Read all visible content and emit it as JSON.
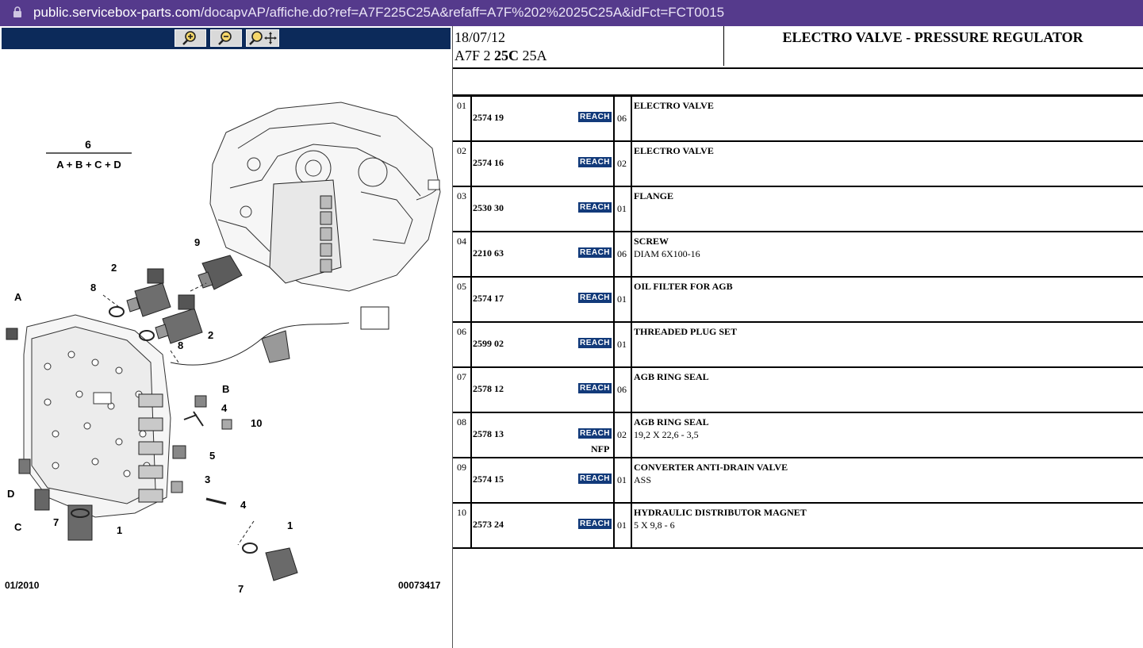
{
  "browser": {
    "url_host": "public.servicebox-parts.com",
    "url_path": "/docapvAP/affiche.do?ref=A7F225C25A&refaff=A7F%202%2025C25A&idFct=FCT0015"
  },
  "toolbar": {
    "zoom_in_icon": "zoom-in-icon",
    "zoom_out_icon": "zoom-out-icon",
    "zoom_pan_icon": "zoom-pan-icon"
  },
  "diagram": {
    "formula_top": "6",
    "formula_bottom": "A + B + C + D",
    "callouts": [
      "A",
      "B",
      "C",
      "D",
      "1",
      "2",
      "3",
      "4",
      "5",
      "7",
      "8",
      "9",
      "10"
    ],
    "date": "01/2010",
    "number": "00073417"
  },
  "header": {
    "date": "18/07/12",
    "code_prefix": "A7F 2 ",
    "code_bold": "25C",
    "code_suffix": " 25A",
    "title": "ELECTRO VALVE - PRESSURE REGULATOR"
  },
  "colors": {
    "address_bar": "#553a8c",
    "toolbar": "#0c2a5a",
    "reach_badge": "#123a7a"
  },
  "parts": [
    {
      "num": "01",
      "ref": "2574 19",
      "badge": "REACH",
      "qty": "06",
      "name": "ELECTRO VALVE",
      "detail": "",
      "note": ""
    },
    {
      "num": "02",
      "ref": "2574 16",
      "badge": "REACH",
      "qty": "02",
      "name": "ELECTRO VALVE",
      "detail": "",
      "note": ""
    },
    {
      "num": "03",
      "ref": "2530 30",
      "badge": "REACH",
      "qty": "01",
      "name": "FLANGE",
      "detail": "",
      "note": ""
    },
    {
      "num": "04",
      "ref": "2210 63",
      "badge": "REACH",
      "qty": "06",
      "name": "SCREW",
      "detail": "DIAM 6X100-16",
      "note": ""
    },
    {
      "num": "05",
      "ref": "2574 17",
      "badge": "REACH",
      "qty": "01",
      "name": "OIL FILTER FOR AGB",
      "detail": "",
      "note": ""
    },
    {
      "num": "06",
      "ref": "2599 02",
      "badge": "REACH",
      "qty": "01",
      "name": "THREADED PLUG SET",
      "detail": "",
      "note": ""
    },
    {
      "num": "07",
      "ref": "2578 12",
      "badge": "REACH",
      "qty": "06",
      "name": "AGB RING SEAL",
      "detail": "",
      "note": ""
    },
    {
      "num": "08",
      "ref": "2578 13",
      "badge": "REACH",
      "qty": "02",
      "name": "AGB RING SEAL",
      "detail": "19,2 X 22,6 - 3,5",
      "note": "NFP"
    },
    {
      "num": "09",
      "ref": "2574 15",
      "badge": "REACH",
      "qty": "01",
      "name": "CONVERTER ANTI-DRAIN VALVE",
      "detail": "ASS",
      "note": ""
    },
    {
      "num": "10",
      "ref": "2573 24",
      "badge": "REACH",
      "qty": "01",
      "name": "HYDRAULIC DISTRIBUTOR MAGNET",
      "detail": "5 X 9,8 - 6",
      "note": ""
    }
  ]
}
